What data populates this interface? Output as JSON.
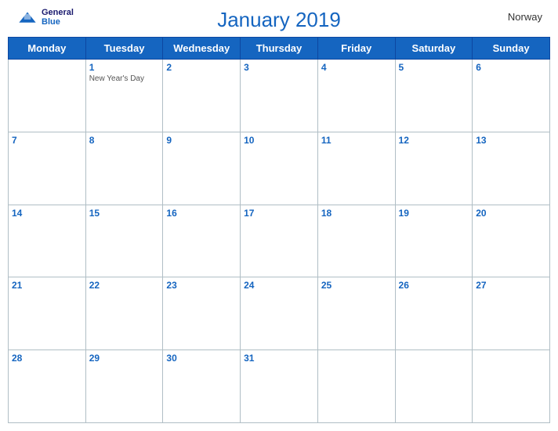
{
  "header": {
    "title": "January 2019",
    "country": "Norway",
    "logo_general": "General",
    "logo_blue": "Blue"
  },
  "weekdays": [
    "Monday",
    "Tuesday",
    "Wednesday",
    "Thursday",
    "Friday",
    "Saturday",
    "Sunday"
  ],
  "weeks": [
    [
      {
        "day": "",
        "empty": true
      },
      {
        "day": "1",
        "event": "New Year's Day"
      },
      {
        "day": "2"
      },
      {
        "day": "3"
      },
      {
        "day": "4"
      },
      {
        "day": "5"
      },
      {
        "day": "6"
      }
    ],
    [
      {
        "day": "7"
      },
      {
        "day": "8"
      },
      {
        "day": "9"
      },
      {
        "day": "10"
      },
      {
        "day": "11"
      },
      {
        "day": "12"
      },
      {
        "day": "13"
      }
    ],
    [
      {
        "day": "14"
      },
      {
        "day": "15"
      },
      {
        "day": "16"
      },
      {
        "day": "17"
      },
      {
        "day": "18"
      },
      {
        "day": "19"
      },
      {
        "day": "20"
      }
    ],
    [
      {
        "day": "21"
      },
      {
        "day": "22"
      },
      {
        "day": "23"
      },
      {
        "day": "24"
      },
      {
        "day": "25"
      },
      {
        "day": "26"
      },
      {
        "day": "27"
      }
    ],
    [
      {
        "day": "28"
      },
      {
        "day": "29"
      },
      {
        "day": "30"
      },
      {
        "day": "31"
      },
      {
        "day": "",
        "empty": true
      },
      {
        "day": "",
        "empty": true
      },
      {
        "day": "",
        "empty": true
      }
    ]
  ]
}
